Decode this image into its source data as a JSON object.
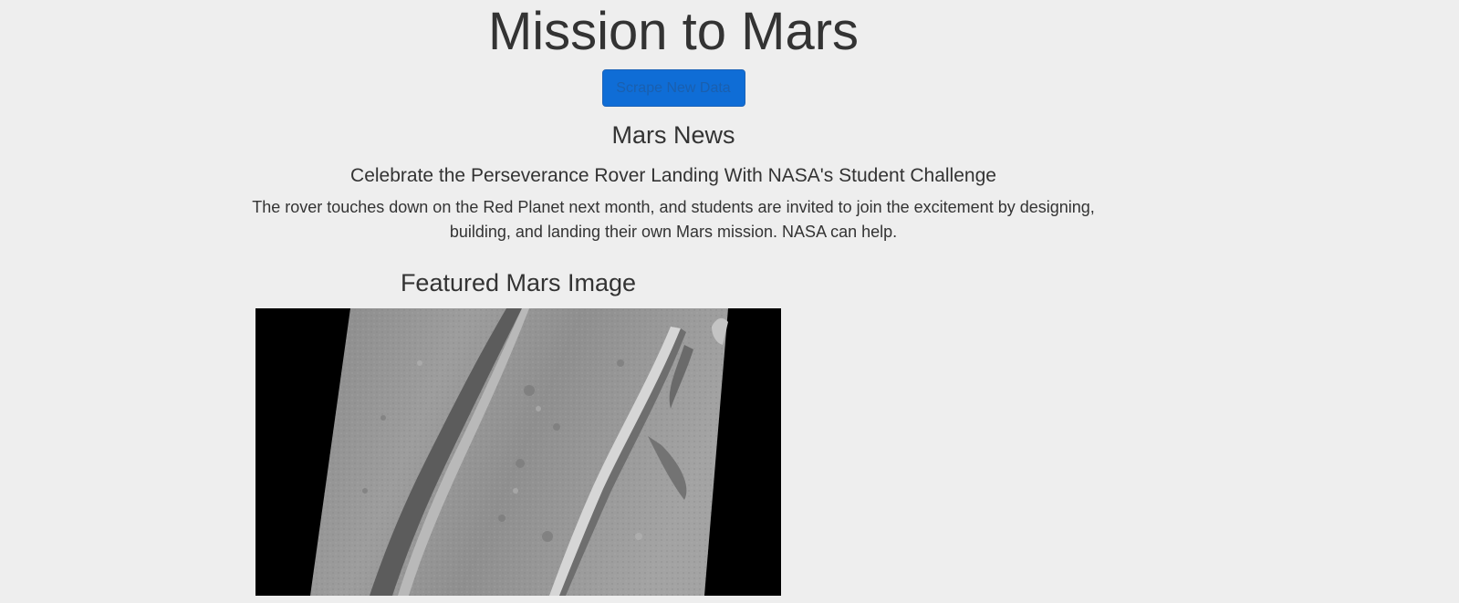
{
  "header": {
    "title": "Mission to Mars",
    "scrape_button_label": "Scrape New Data"
  },
  "news": {
    "section_title": "Mars News",
    "headline": "Celebrate the Perseverance Rover Landing With NASA's Student Challenge",
    "teaser": "The rover touches down on the Red Planet next month, and students are invited to join the excitement by designing, building, and landing their own Mars mission. NASA can help."
  },
  "featured_image": {
    "section_title": "Featured Mars Image",
    "image_icon": "mars-surface-photo"
  },
  "colors": {
    "background": "#eeeeee",
    "text": "#333333",
    "button": "#0f6dd6"
  }
}
